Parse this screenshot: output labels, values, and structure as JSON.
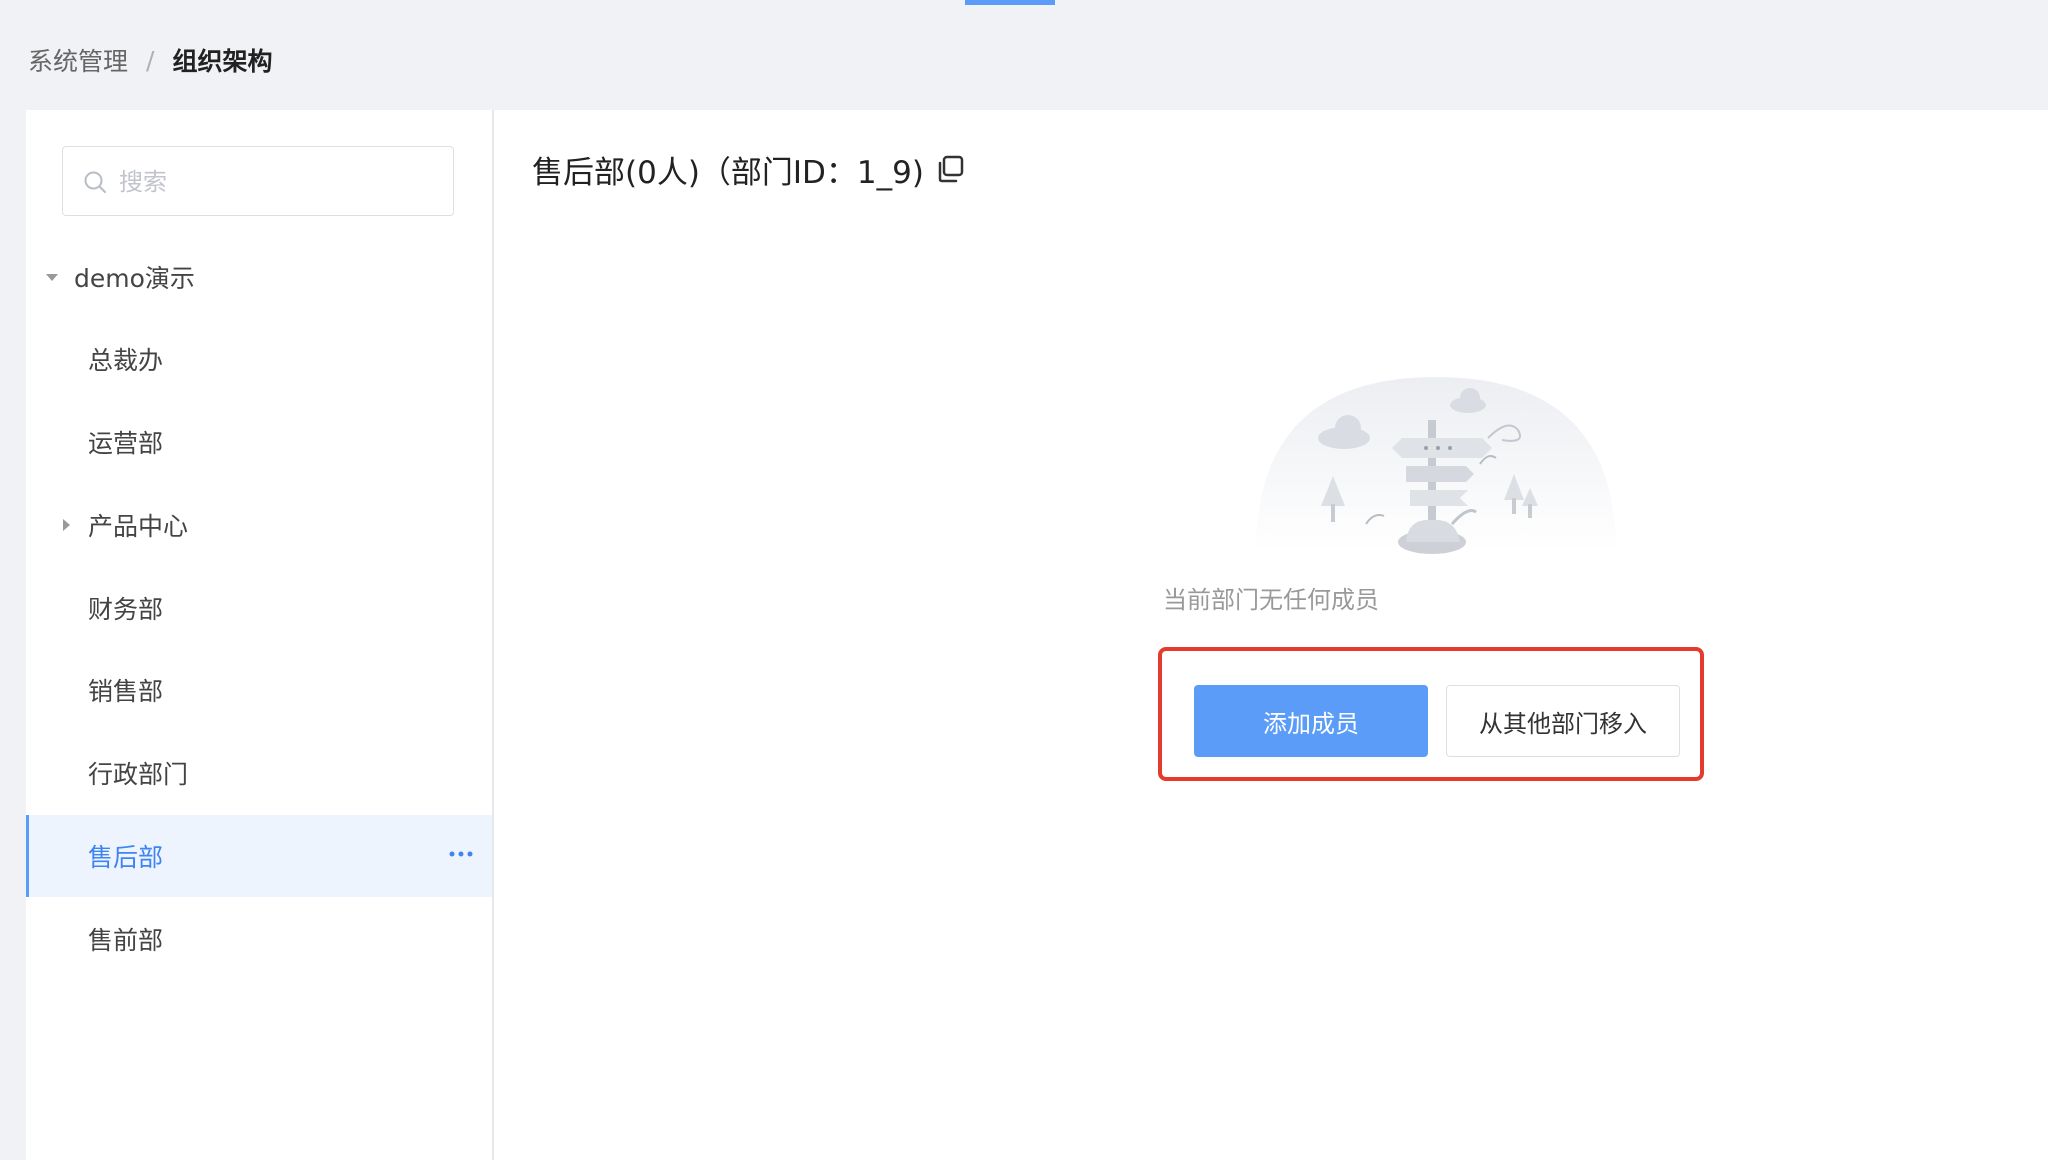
{
  "breadcrumb": {
    "parent": "系统管理",
    "separator": "/",
    "current": "组织架构"
  },
  "search": {
    "placeholder": "搜索"
  },
  "tree": {
    "root": "demo演示",
    "items": [
      {
        "label": "总裁办",
        "expandable": false
      },
      {
        "label": "运营部",
        "expandable": false
      },
      {
        "label": "产品中心",
        "expandable": true
      },
      {
        "label": "财务部",
        "expandable": false
      },
      {
        "label": "销售部",
        "expandable": false
      },
      {
        "label": "行政部门",
        "expandable": false
      },
      {
        "label": "售后部",
        "expandable": false,
        "selected": true
      },
      {
        "label": "售前部",
        "expandable": false
      }
    ]
  },
  "main": {
    "title": "售后部(0人)（部门ID：1_9)",
    "empty_text": "当前部门无任何成员",
    "add_member_button": "添加成员",
    "move_from_other_button": "从其他部门移入"
  },
  "colors": {
    "accent": "#5b9cf8",
    "highlight": "#e53b2c",
    "active_bg": "#eef4fd"
  },
  "icons": [
    "search-icon",
    "caret-down-icon",
    "caret-right-icon",
    "more-icon",
    "copy-icon",
    "empty-signpost-illustration"
  ]
}
